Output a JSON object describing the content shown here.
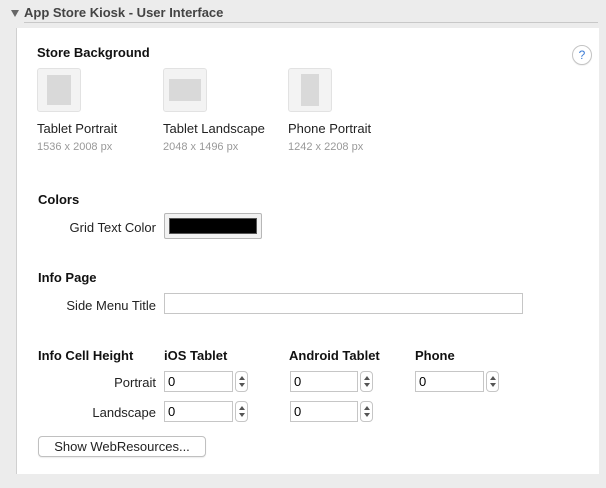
{
  "header": {
    "title": "App Store Kiosk - User Interface"
  },
  "help": {
    "label": "?"
  },
  "store_background": {
    "heading": "Store Background",
    "items": [
      {
        "label": "Tablet Portrait",
        "size": "1536 x 2008 px"
      },
      {
        "label": "Tablet Landscape",
        "size": "2048 x 1496 px"
      },
      {
        "label": "Phone Portrait",
        "size": "1242 x 2208 px"
      }
    ]
  },
  "colors": {
    "heading": "Colors",
    "grid_text_label": "Grid Text Color",
    "grid_text_value": "#000000"
  },
  "info_page": {
    "heading": "Info Page",
    "side_menu_label": "Side Menu Title",
    "side_menu_value": ""
  },
  "info_cell_height": {
    "heading": "Info Cell Height",
    "columns": [
      "iOS Tablet",
      "Android Tablet",
      "Phone"
    ],
    "portrait_label": "Portrait",
    "landscape_label": "Landscape",
    "portrait": {
      "ios_tablet": "0",
      "android_tablet": "0",
      "phone": "0"
    },
    "landscape": {
      "ios_tablet": "0",
      "android_tablet": "0"
    }
  },
  "web_resources_button": "Show WebResources..."
}
